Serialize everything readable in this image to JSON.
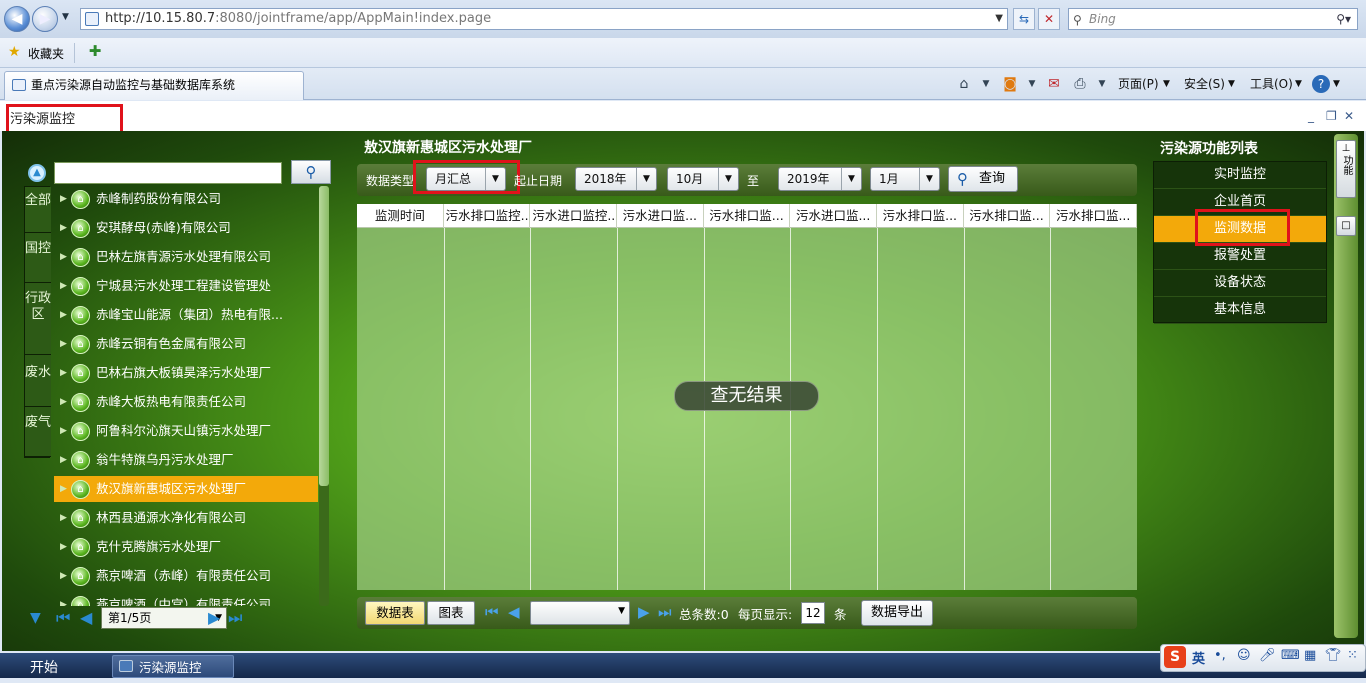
{
  "browser": {
    "url_prefix": "http://10.15.80.7",
    "url_rest": ":8080/jointframe/app/AppMain!index.page",
    "search_placeholder": "Bing",
    "favorites_label": "收藏夹",
    "tab_title": "重点污染源自动监控与基础数据库系统",
    "commands": [
      "页面(P)",
      "安全(S)",
      "工具(O)"
    ]
  },
  "app": {
    "window_title": "污染源监控",
    "plant_title": "敖汉旗新惠城区污水处理厂",
    "left_panel": {
      "categories": [
        "全部",
        "国控",
        "行政区",
        "废水",
        "废气"
      ],
      "companies": [
        "赤峰制药股份有限公司",
        "安琪酵母(赤峰)有限公司",
        "巴林左旗青源污水处理有限公司",
        "宁城县污水处理工程建设管理处",
        "赤峰宝山能源（集团）热电有限...",
        "赤峰云铜有色金属有限公司",
        "巴林右旗大板镇昊泽污水处理厂",
        "赤峰大板热电有限责任公司",
        "阿鲁科尔沁旗天山镇污水处理厂",
        "翁牛特旗乌丹污水处理厂",
        "敖汉旗新惠城区污水处理厂",
        "林西县通源水净化有限公司",
        "克什克腾旗污水处理厂",
        "燕京啤酒（赤峰）有限责任公司",
        "燕京啤酒（中宫）有限责任公司"
      ],
      "selected_index": 10,
      "pager_label": "第1/5页"
    },
    "toolbar": {
      "data_type_label": "数据类型",
      "data_type_value": "月汇总",
      "date_label": "起止日期",
      "start_year": "2018年",
      "start_month": "10月",
      "to_label": "至",
      "end_year": "2019年",
      "end_month": "1月",
      "query_label": "查询"
    },
    "grid": {
      "columns": [
        "监测时间",
        "污水排口监控...",
        "污水进口监控...",
        "污水进口监...",
        "污水排口监...",
        "污水进口监...",
        "污水排口监...",
        "污水排口监...",
        "污水排口监..."
      ],
      "empty_message": "查无结果"
    },
    "bottom": {
      "tab_table": "数据表",
      "tab_chart": "图表",
      "total_label": "总条数:0",
      "per_page_label": "每页显示:",
      "per_page_value": "12",
      "unit_label": "条",
      "export_label": "数据导出"
    },
    "right_panel": {
      "title": "污染源功能列表",
      "items": [
        "实时监控",
        "企业首页",
        "监测数据",
        "报警处置",
        "设备状态",
        "基本信息"
      ],
      "selected_index": 2,
      "strip_label": "功能"
    }
  },
  "taskbar": {
    "start_label": "开始",
    "task_label": "污染源监控",
    "ime_label": "英"
  },
  "colors": {
    "selected": "#f3a90a",
    "highlight_box": "#e0121b"
  }
}
